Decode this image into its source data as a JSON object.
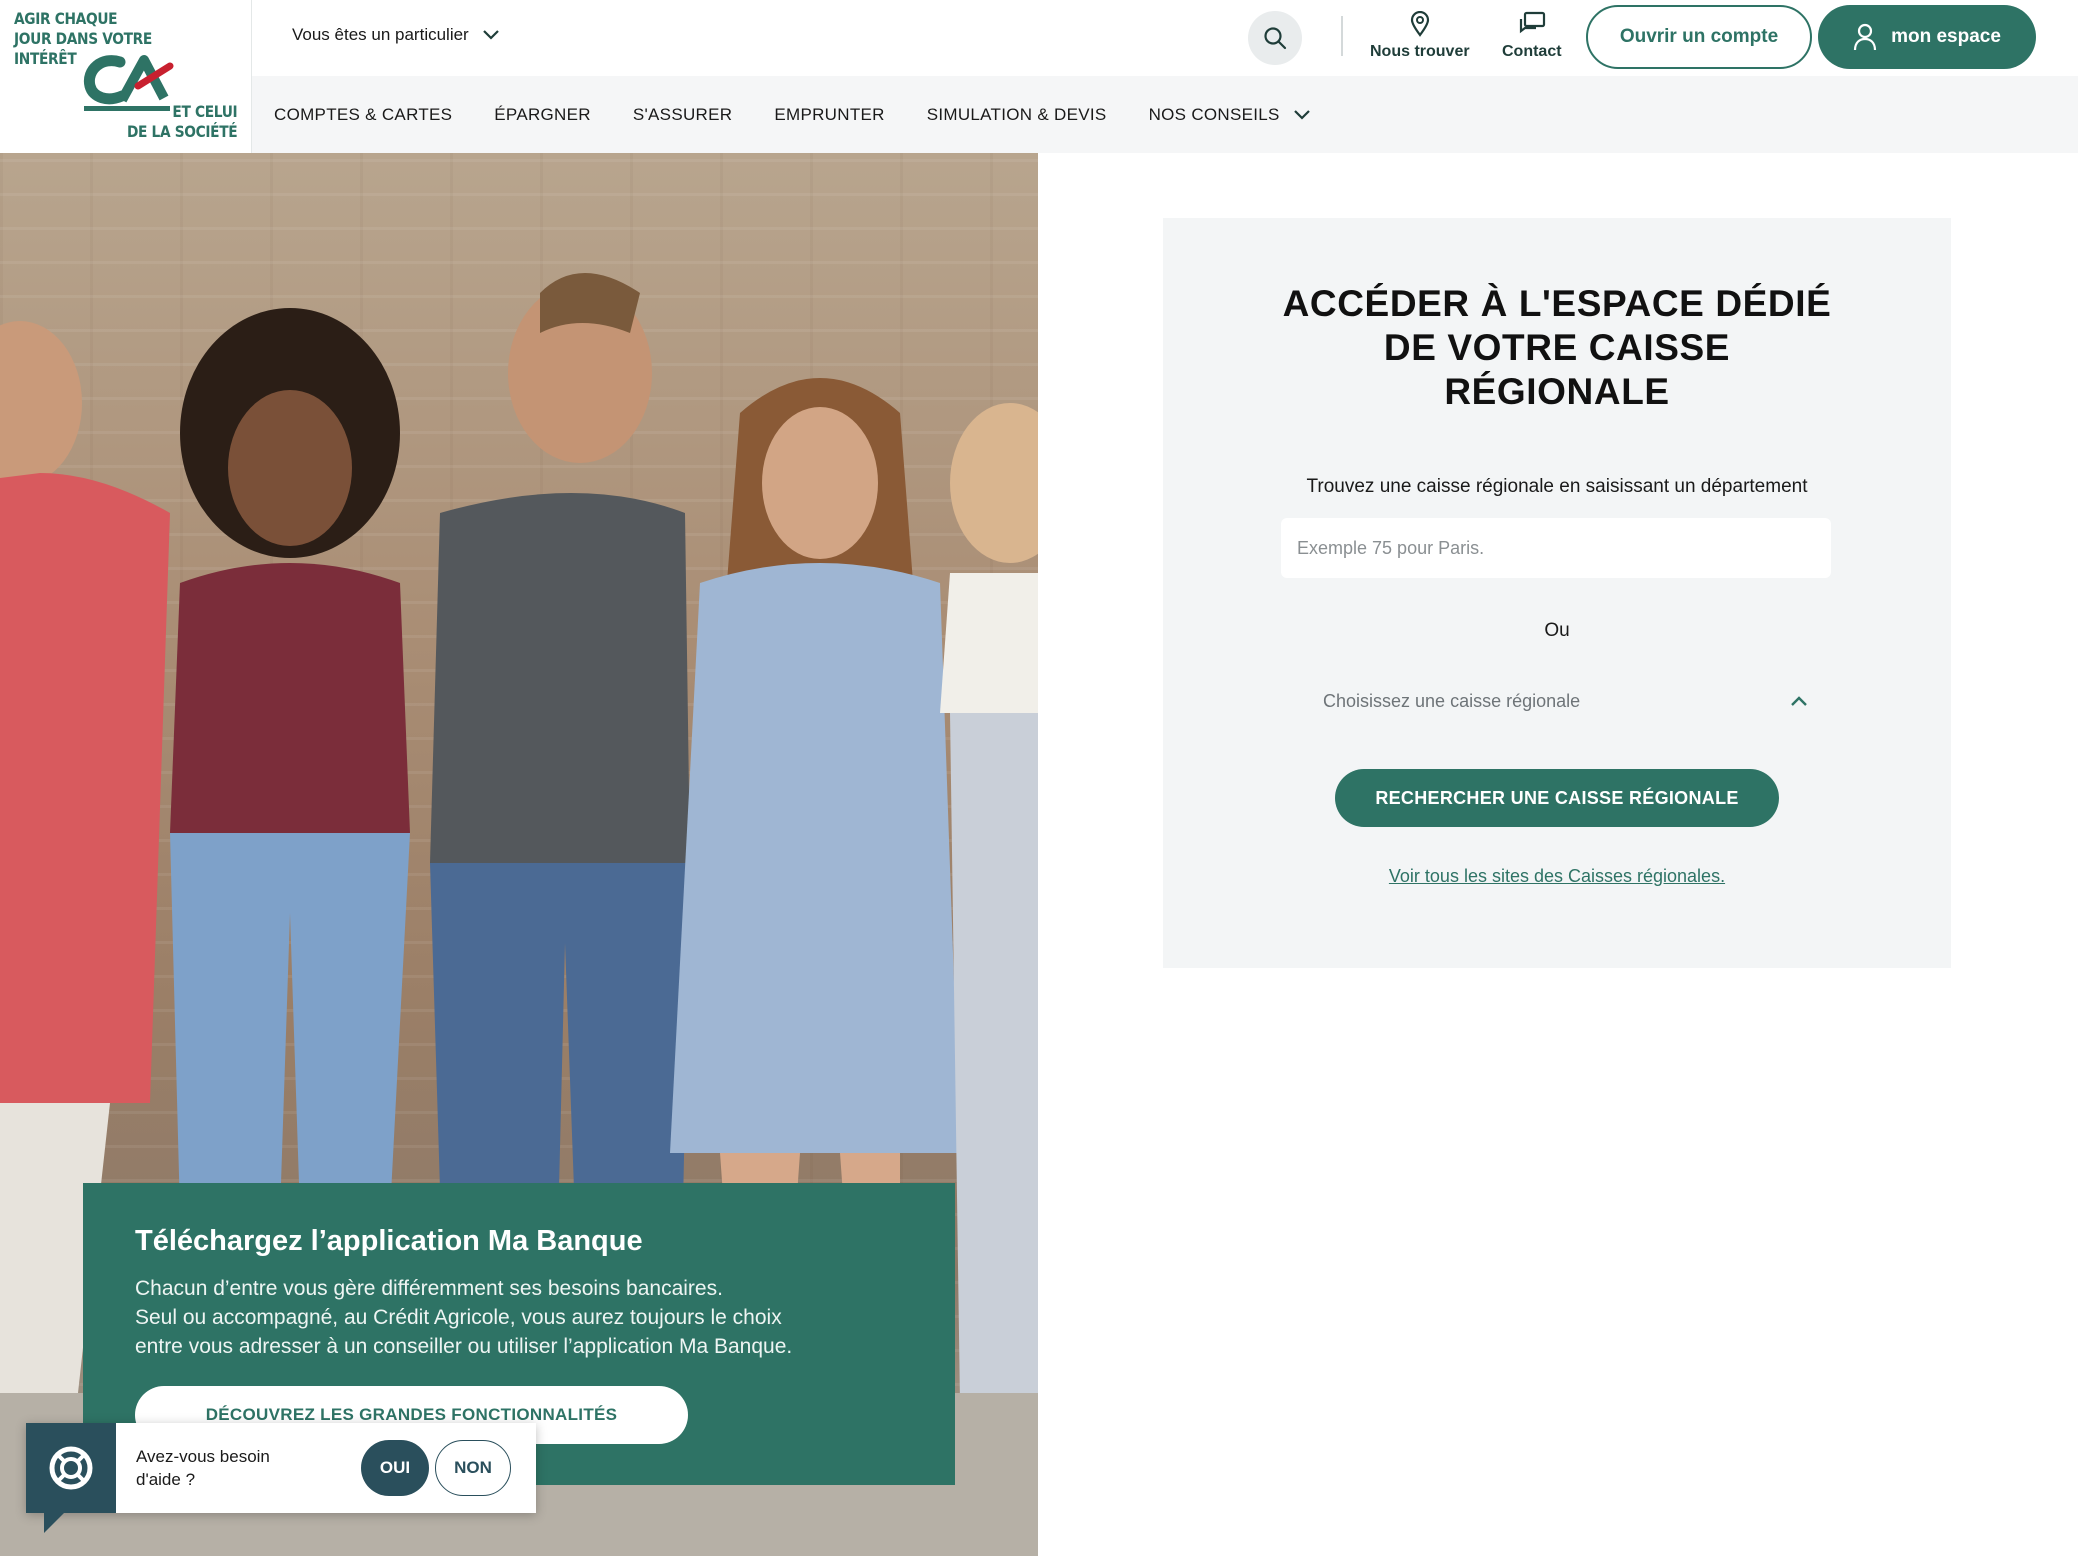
{
  "logo": {
    "tagline_top": "AGIR CHAQUE\nJOUR DANS VOTRE\nINTÉRÊT",
    "tagline_bottom": "ET CELUI\nDE LA SOCIÉTÉ",
    "mark": "CA"
  },
  "header": {
    "profile_select": "Vous êtes un particulier",
    "links": [
      {
        "label": "Nous trouver",
        "icon": "map-pin-icon"
      },
      {
        "label": "Contact",
        "icon": "chat-icon"
      }
    ],
    "open_account": "Ouvrir un compte",
    "my_space": "mon espace"
  },
  "nav": {
    "items": [
      "COMPTES & CARTES",
      "ÉPARGNER",
      "S'ASSURER",
      "EMPRUNTER",
      "SIMULATION & DEVIS",
      "NOS CONSEILS"
    ]
  },
  "promo": {
    "title": "Téléchargez l’application Ma Banque",
    "text_line1": "Chacun d’entre vous gère différemment ses besoins bancaires.",
    "text_line2": "Seul ou accompagné, au Crédit Agricole, vous aurez toujours le choix",
    "text_line3": "entre vous adresser à un conseiller ou utiliser l’application Ma Banque.",
    "button": "DÉCOUVREZ LES GRANDES FONCTIONNALITÉS"
  },
  "help": {
    "question_line1": "Avez-vous besoin",
    "question_line2": "d'aide ?",
    "yes": "OUI",
    "no": "NON"
  },
  "panel": {
    "title_line1": "ACCÉDER À L'ESPACE DÉDIÉ",
    "title_line2": "DE VOTRE CAISSE",
    "title_line3": "RÉGIONALE",
    "subtitle": "Trouvez une caisse régionale en saisissant un département",
    "input_placeholder": "Exemple 75 pour Paris.",
    "or": "Ou",
    "select_value": "Choisissez une caisse régionale",
    "search_button": "RECHERCHER UNE CAISSE RÉGIONALE",
    "all_sites_link": "Voir tous les sites des Caisses régionales."
  },
  "colors": {
    "brand_green": "#2e7365",
    "help_dark": "#2a4f5c",
    "panel_bg": "#f3f5f6",
    "nav_bg": "#f5f6f7",
    "logo_red": "#c8202f"
  }
}
